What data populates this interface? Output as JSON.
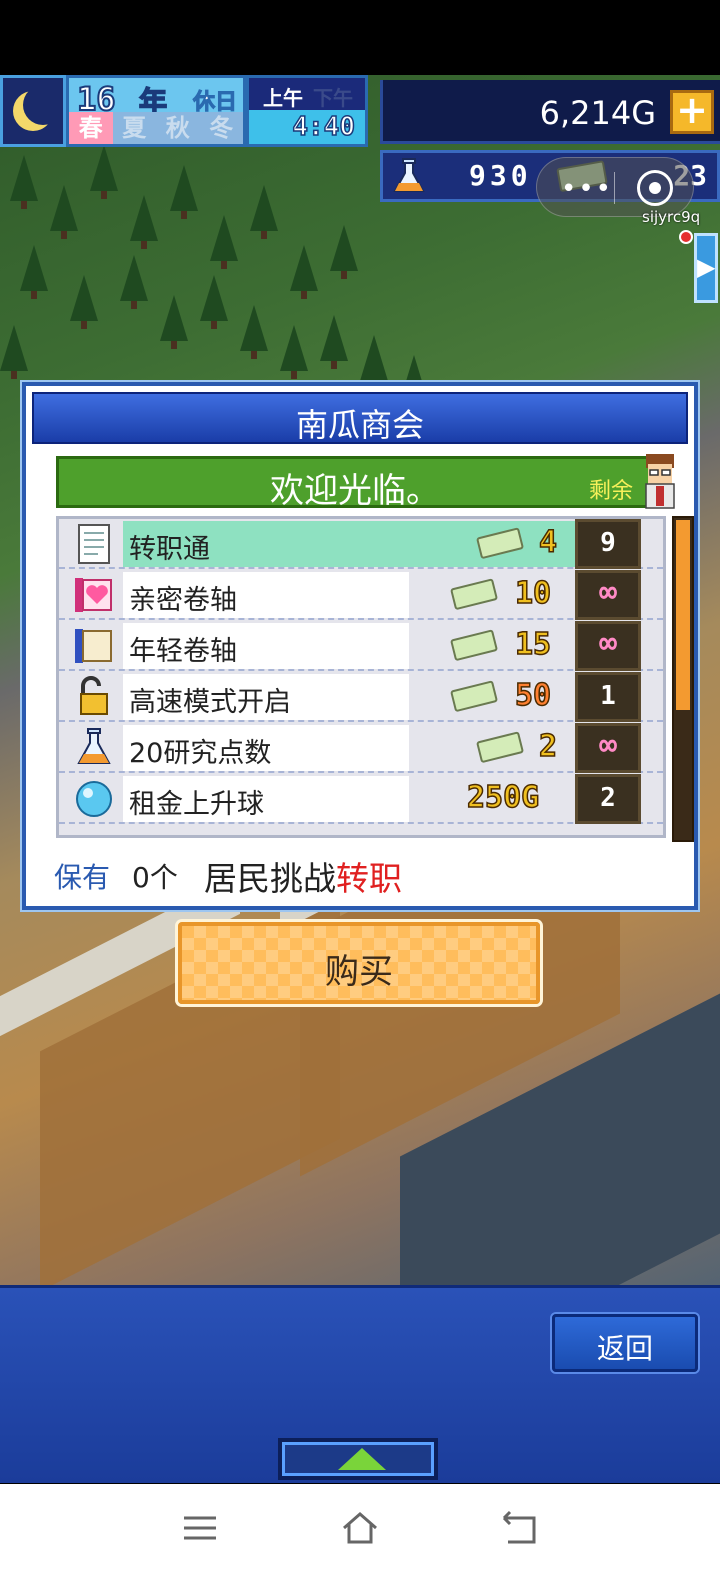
{
  "hud": {
    "year": "16",
    "year_unit": "年",
    "holiday": "休日",
    "am": "上午",
    "pm": "下午",
    "seasons": [
      "春",
      "夏",
      "秋",
      "冬"
    ],
    "active_season": "春",
    "clock": "4:40",
    "money": "6,214G",
    "research_points": "930",
    "tickets": "23"
  },
  "overlay": {
    "user_tag": "sijyrc9q"
  },
  "shop": {
    "title": "南瓜商会",
    "welcome": "欢迎光临。",
    "remaining_label": "剩余",
    "items": [
      {
        "name": "转职通",
        "price": "4",
        "price_type": "ticket",
        "stock": "9",
        "icon": "document-icon",
        "selected": true
      },
      {
        "name": "亲密卷轴",
        "price": "10",
        "price_type": "ticket",
        "stock": "∞",
        "icon": "heart-scroll-icon",
        "selected": false
      },
      {
        "name": "年轻卷轴",
        "price": "15",
        "price_type": "ticket",
        "stock": "∞",
        "icon": "scroll-icon",
        "selected": false
      },
      {
        "name": "高速模式开启",
        "price": "50",
        "price_type": "ticket",
        "stock": "1",
        "icon": "unlock-icon",
        "selected": false
      },
      {
        "name": "20研究点数",
        "price": "2",
        "price_type": "ticket",
        "stock": "∞",
        "icon": "flask-icon",
        "selected": false
      },
      {
        "name": "租金上升球",
        "price": "250G",
        "price_type": "gold",
        "stock": "2",
        "icon": "orb-icon",
        "selected": false
      }
    ],
    "own_label": "保有",
    "own_count": "0个",
    "description": "居民挑战",
    "description_highlight": "转职",
    "buy_label": "购买"
  },
  "bottom": {
    "back_label": "返回"
  },
  "colors": {
    "panel_blue": "#1b3c9a",
    "selected_row": "#8ee1c1",
    "welcome_green": "#4ea02c",
    "highlight_red": "#e02020"
  }
}
